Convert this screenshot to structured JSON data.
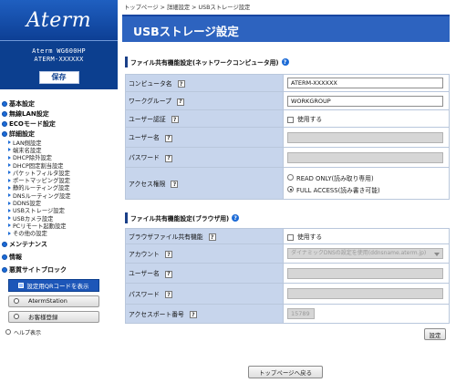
{
  "sidebar": {
    "logo": "Aterm",
    "model_line1": "Aterm WG600HP",
    "model_line2": "ATERM-XXXXXX",
    "save_label": "保存",
    "nav": {
      "basic": "基本設定",
      "wireless": "無線LAN設定",
      "eco": "ECOモード設定",
      "detail": "詳細設定",
      "detail_items": [
        "LAN側設定",
        "端末名設定",
        "DHCP除外設定",
        "DHCP固定割当設定",
        "パケットフィルタ設定",
        "ポートマッピング設定",
        "静的ルーティング設定",
        "DNSルーティング設定",
        "DDNS設定",
        "USBストレージ設定",
        "USBカメラ設定",
        "PCリモート起動設定",
        "その他の設定"
      ],
      "maintenance": "メンテナンス",
      "info": "情報",
      "malicious": "悪質サイトブロック"
    },
    "qr_button": "設定用QRコードを表示",
    "atermstation": "AtermStation",
    "customer_reg": "お客様登録",
    "help": "ヘルプ表示"
  },
  "breadcrumb": {
    "top": "トップページ",
    "sep1": ">",
    "detail": "詳細設定",
    "sep2": ">",
    "current": "USBストレージ設定"
  },
  "page_title": "USBストレージ設定",
  "network_section": {
    "title": "ファイル共有機能設定(ネットワークコンピュータ用)",
    "computer_name_label": "コンピュータ名",
    "computer_name_value": "ATERM-XXXXXX",
    "workgroup_label": "ワークグループ",
    "workgroup_value": "WORKGROUP",
    "user_auth_label": "ユーザー認証",
    "user_auth_option": "使用する",
    "username_label": "ユーザー名",
    "password_label": "パスワード",
    "access_label": "アクセス権限",
    "access_read_only": "READ ONLY(読み取り専用)",
    "access_full": "FULL ACCESS(読み書き可能)",
    "access_selected": "FULL ACCESS(読み書き可能)"
  },
  "browser_section": {
    "title": "ファイル共有機能設定(ブラウザ用)",
    "browser_share_label": "ブラウザファイル共有機能",
    "browser_share_option": "使用する",
    "account_label": "アカウント",
    "account_value": "ダイナミックDNSの設定を使用(ddnsname.aterm.jp)",
    "username_label": "ユーザー名",
    "password_label": "パスワード",
    "port_label": "アクセスポート番号",
    "port_value": "15789"
  },
  "buttons": {
    "set": "設定",
    "back_top": "トップページへ戻る"
  },
  "colors": {
    "accent": "#2d63bf",
    "sidebar_dark": "#0c3f8f",
    "label_bg": "#c7d5ec"
  }
}
